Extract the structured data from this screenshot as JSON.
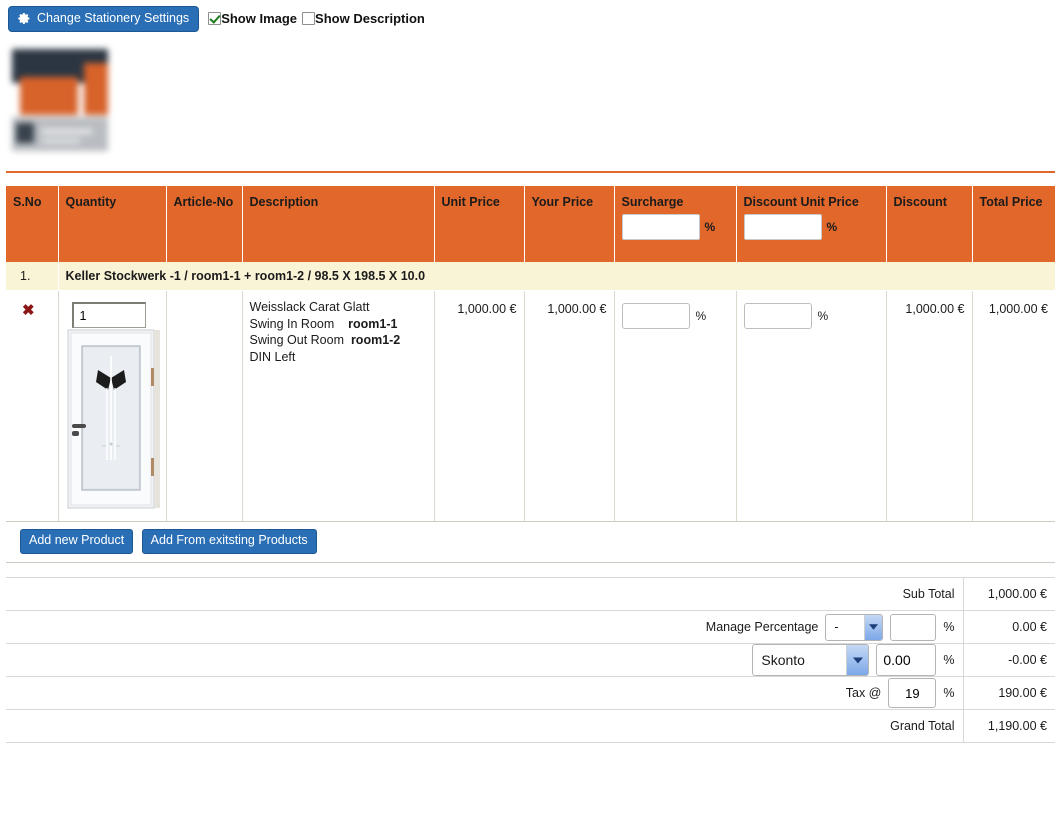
{
  "toolbar": {
    "settings_button": "Change Stationery Settings",
    "gear_icon": "gear-icon",
    "show_image_label": "Show Image",
    "show_image_checked": true,
    "show_description_label": "Show Description",
    "show_description_checked": false
  },
  "table": {
    "headers": {
      "sno": "S.No",
      "quantity": "Quantity",
      "article_no": "Article-No",
      "description": "Description",
      "unit_price": "Unit Price",
      "your_price": "Your Price",
      "surcharge": "Surcharge",
      "discount_unit_price": "Discount Unit Price",
      "discount": "Discount",
      "total_price": "Total Price"
    },
    "header_inputs": {
      "surcharge_value": "",
      "surcharge_pct": "%",
      "discount_unit_price_value": "",
      "discount_unit_price_pct": "%"
    },
    "group_row": {
      "sno": "1.",
      "title": "Keller Stockwerk -1 / room1-1 + room1-2 / 98.5 X 198.5 X 10.0"
    },
    "item": {
      "delete_icon": "✖",
      "quantity": "1",
      "article_no": "",
      "product_image": "door-image",
      "description_lines": [
        {
          "text": "Weisslack Carat Glatt",
          "value": ""
        },
        {
          "text": "Swing In Room",
          "value": "room1-1"
        },
        {
          "text": "Swing Out Room",
          "value": "room1-2"
        },
        {
          "text": "DIN Left",
          "value": ""
        }
      ],
      "unit_price": "1,000.00 €",
      "your_price": "1,000.00 €",
      "surcharge_value": "",
      "surcharge_pct": "%",
      "discount_unit_price_value": "",
      "discount_unit_price_pct": "%",
      "discount": "1,000.00 €",
      "total_price": "1,000.00 €"
    },
    "actions": {
      "add_new_product": "Add new Product",
      "add_from_existing": "Add From exitsting Products"
    }
  },
  "totals": {
    "sub_total_label": "Sub Total",
    "sub_total_value": "1,000.00 €",
    "manage_percentage_label": "Manage Percentage",
    "manage_percentage_select": "-",
    "manage_percentage_input": "",
    "manage_percentage_pct": "%",
    "manage_percentage_value": "0.00 €",
    "skonto_select": "Skonto",
    "skonto_input": "0.00",
    "skonto_pct": "%",
    "skonto_value": "-0.00 €",
    "tax_label": "Tax @",
    "tax_input": "19",
    "tax_pct": "%",
    "tax_value": "190.00 €",
    "grand_total_label": "Grand Total",
    "grand_total_value": "1,190.00 €"
  },
  "colors": {
    "header_orange": "#e2672a",
    "group_row": "#faf4d7",
    "button_blue": "#2a6fb5",
    "delete_red": "#8c1616"
  }
}
